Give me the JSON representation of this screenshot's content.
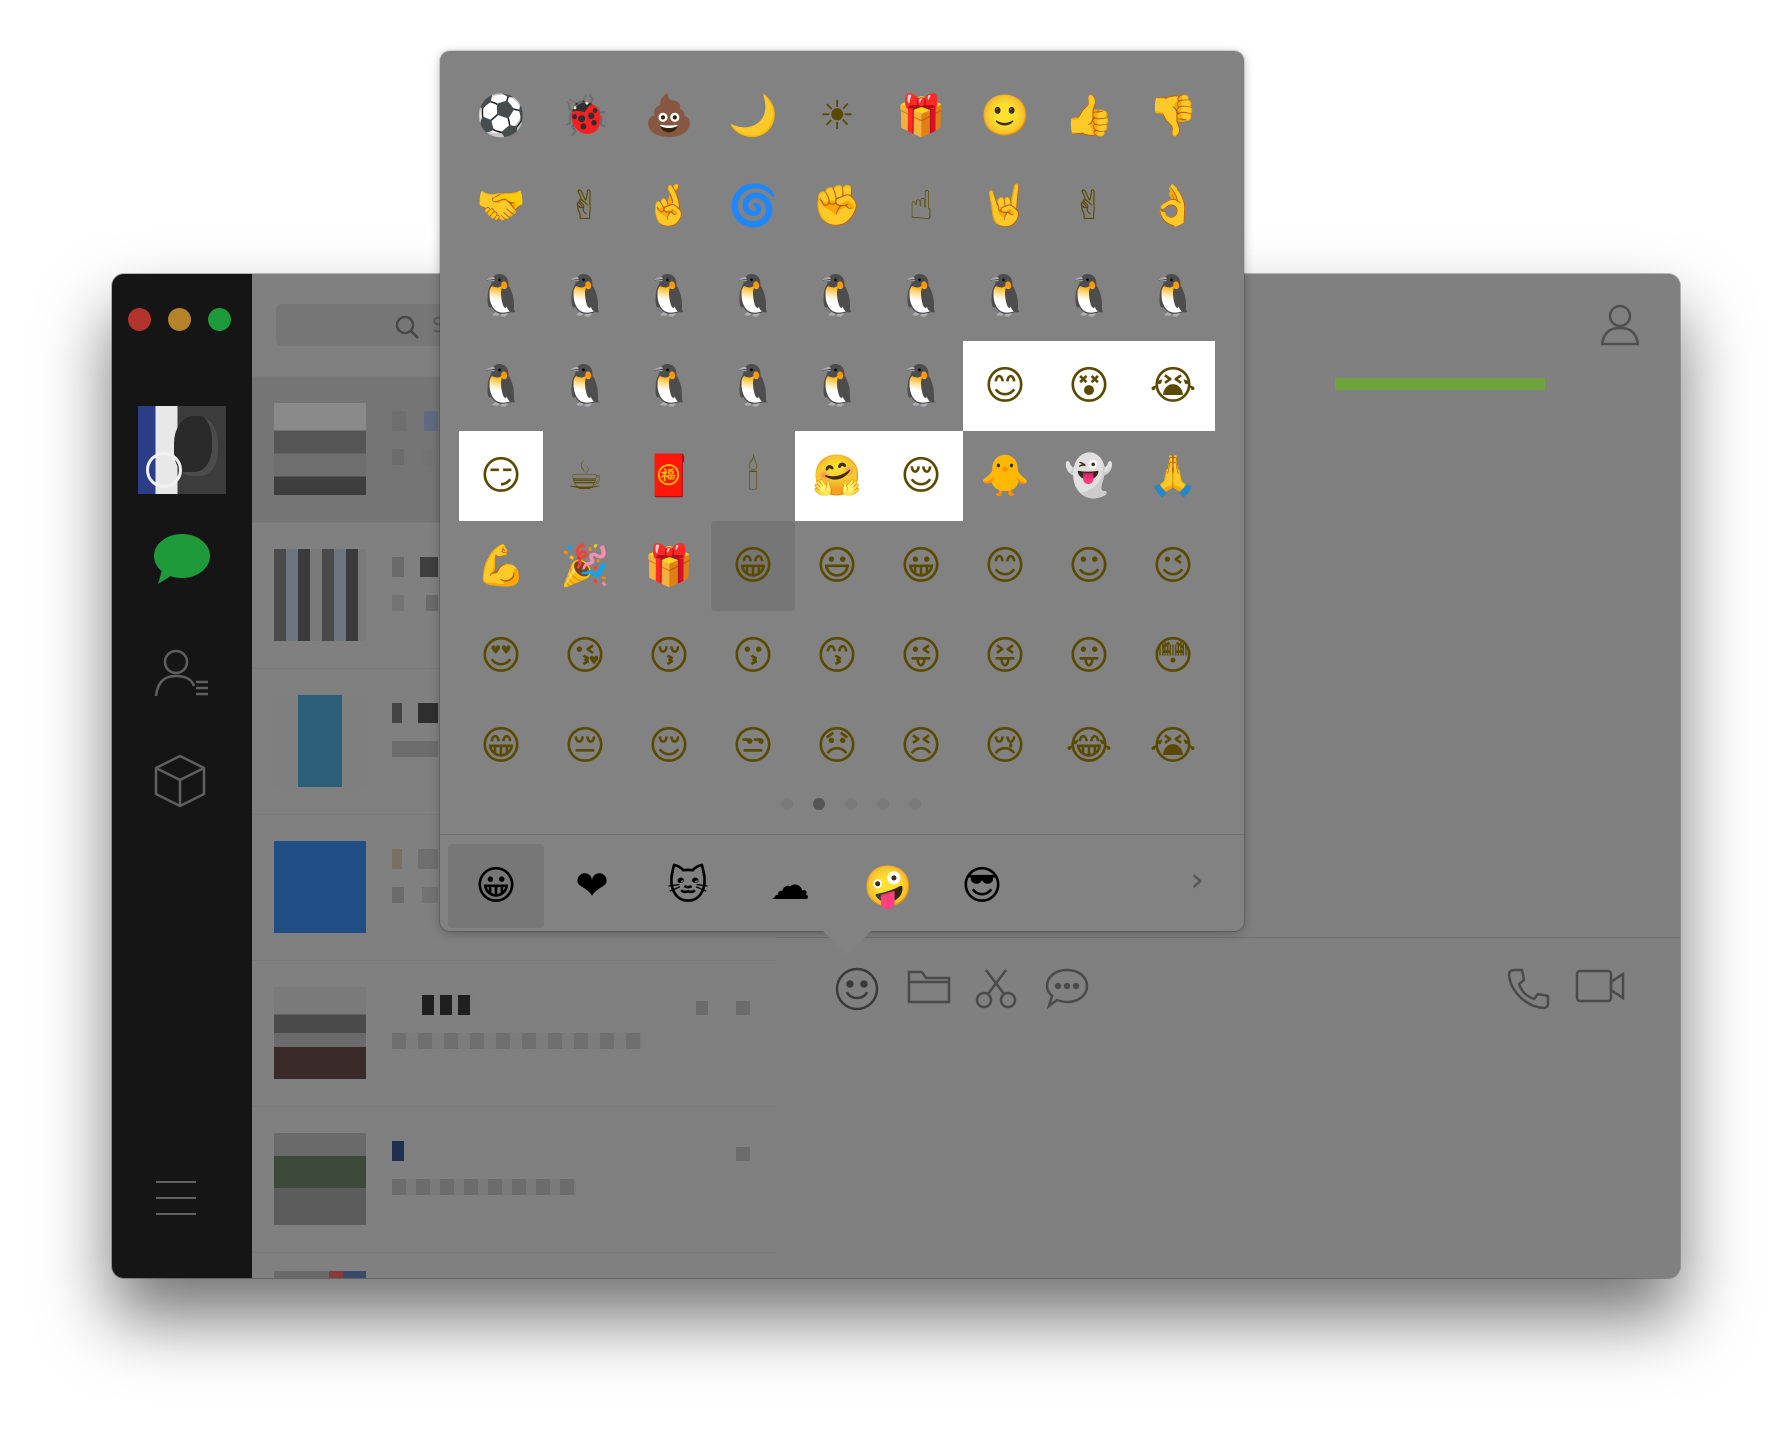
{
  "search": {
    "placeholder": "S"
  },
  "conversations": [
    {
      "id": "c1",
      "selected": true
    },
    {
      "id": "c2",
      "selected": false
    },
    {
      "id": "c3",
      "selected": false
    },
    {
      "id": "c4",
      "selected": false
    },
    {
      "id": "c5",
      "selected": false
    },
    {
      "id": "c6",
      "selected": false
    },
    {
      "id": "c7",
      "selected": false
    }
  ],
  "emoji_picker": {
    "rows": [
      [
        "⚽",
        "🐞",
        "💩",
        "🌙",
        "☀",
        "🎁",
        "🙂",
        "👍",
        "👎"
      ],
      [
        "🤝",
        "✌",
        "🤞",
        "🌀",
        "✊",
        "☝",
        "🤘",
        "✌",
        "👌"
      ],
      [
        "🐧",
        "🐧",
        "🐧",
        "🐧",
        "🐧",
        "🐧",
        "🐧",
        "🐧",
        "🐧"
      ],
      [
        "🐧",
        "🐧",
        "🐧",
        "🐧",
        "🐧",
        "🐧",
        "😊",
        "😵",
        "😭"
      ],
      [
        "😏",
        "☕",
        "🧧",
        "🕯",
        "🤗",
        "😌",
        "🐥",
        "👻",
        "🙏"
      ],
      [
        "💪",
        "🎉",
        "🎁",
        "😁",
        "😃",
        "😀",
        "😊",
        "☺",
        "😉"
      ],
      [
        "😍",
        "😘",
        "😚",
        "😗",
        "😙",
        "😜",
        "😝",
        "😛",
        "😳"
      ],
      [
        "😁",
        "😔",
        "😌",
        "😒",
        "😞",
        "😣",
        "😢",
        "😂",
        "😭"
      ]
    ],
    "white_cells": [
      [
        3,
        6
      ],
      [
        3,
        7
      ],
      [
        3,
        8
      ],
      [
        4,
        0
      ],
      [
        4,
        4
      ],
      [
        4,
        5
      ]
    ],
    "hover_cell": [
      5,
      3
    ],
    "page_count": 5,
    "active_page": 1,
    "tabs": [
      {
        "icon": "smiley-tab-icon",
        "glyph": "😀",
        "active": true
      },
      {
        "icon": "heart-tab-icon",
        "glyph": "❤",
        "active": false
      },
      {
        "icon": "cat-sticker-tab-icon",
        "glyph": "🐱",
        "active": false
      },
      {
        "icon": "blob-sticker-tab-icon",
        "glyph": "☁",
        "active": false
      },
      {
        "icon": "crazy-face-tab-icon",
        "glyph": "🤪",
        "active": false
      },
      {
        "icon": "sunglasses-tab-icon",
        "glyph": "😎",
        "active": false
      }
    ]
  },
  "colors": {
    "sidebar": "#151515",
    "overlay_gray": "#808080",
    "accent_green": "#6ea33c",
    "chat_icon_green": "#1f9a3a",
    "highlight": "#ffffff"
  }
}
